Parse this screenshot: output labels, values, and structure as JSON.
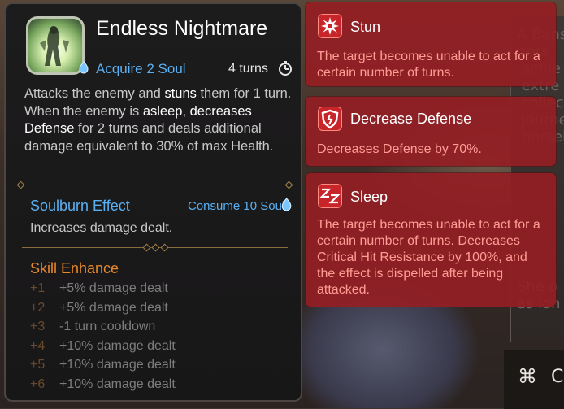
{
  "background": {
    "text_lines": "A Bans\nghts\n achie\n extre\n collec\n journe\n hersel",
    "lower_text_lines": "She o\nas lon",
    "bottom_icon_glyph": "⌘",
    "bottom_cut_text": "C",
    "colors": {
      "panel": "#3d3734"
    }
  },
  "skill": {
    "name": "Endless Nightmare",
    "acquire_text": "Acquire 2 Soul",
    "turns_text": "4 turns",
    "icons": {
      "skill": "nightmare-skill-icon",
      "soul": "soul-icon",
      "cooldown": "stopwatch-icon"
    },
    "description": {
      "p1": "Attacks the enemy and ",
      "k1": "stuns",
      "p2": " them for 1 turn. When the enemy is ",
      "k2": "asleep",
      "p3": ", ",
      "k3": "decreases Defense",
      "p4": " for 2 turns and deals additional damage equivalent to 30% of max Health."
    }
  },
  "soulburn": {
    "title": "Soulburn Effect",
    "consume_text": "Consume 10 Soul",
    "description": "Increases damage dealt."
  },
  "enhance": {
    "title": "Skill Enhance",
    "levels": [
      {
        "level": "+1",
        "text": "+5% damage dealt"
      },
      {
        "level": "+2",
        "text": "+5% damage dealt"
      },
      {
        "level": "+3",
        "text": "-1 turn cooldown"
      },
      {
        "level": "+4",
        "text": "+10% damage dealt"
      },
      {
        "level": "+5",
        "text": "+10% damage dealt"
      },
      {
        "level": "+6",
        "text": "+10% damage dealt"
      }
    ]
  },
  "effects": [
    {
      "name": "Stun",
      "icon": "stun-icon",
      "description": "The target becomes unable to act for a certain number of turns."
    },
    {
      "name": "Decrease Defense",
      "icon": "broken-shield-icon",
      "description": "Decreases Defense by 70%."
    },
    {
      "name": "Sleep",
      "icon": "sleep-icon",
      "description": "The target becomes unable to act for a certain number of turns. Decreases Critical Hit Resistance by 100%, and the effect is dispelled after being attacked."
    }
  ],
  "colors": {
    "soul_blue": "#5ab0f2",
    "enhance_orange": "#e6872b",
    "effect_red": "#941e24",
    "effect_desc": "#ff9d95"
  }
}
